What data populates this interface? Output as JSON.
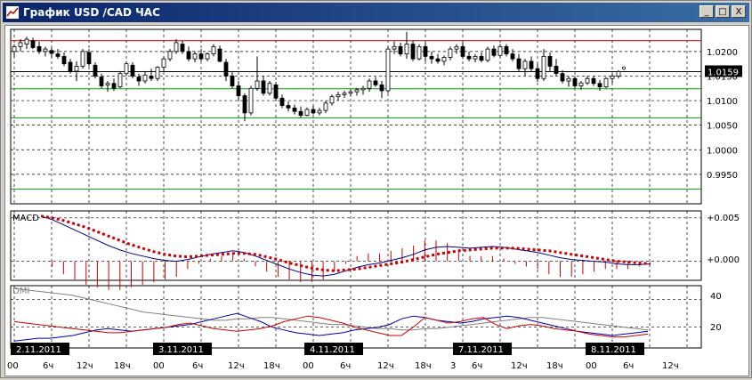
{
  "window": {
    "title": "График USD /CAD  ЧАС",
    "minimize_label": "_",
    "maximize_label": "□",
    "close_label": "X"
  },
  "price_panel": {
    "levels": [
      1.02,
      1.015,
      1.01,
      1.005,
      1.0,
      0.995
    ],
    "level_labels": [
      "1.0200",
      "1.0150",
      "1.0100",
      "1.0050",
      "1.0000",
      "0.9950"
    ],
    "current_price": 1.0159,
    "current_price_label": "1.0159",
    "red_line": 1.0222,
    "green_lines": [
      1.0124,
      1.0065,
      0.992
    ],
    "colors": {
      "red_line": "#c00000",
      "green_line": "#00a000",
      "price_line": "#000000"
    },
    "candles": [
      [
        1.02,
        1.0215,
        1.019,
        1.021
      ],
      [
        1.021,
        1.0225,
        1.02,
        1.0218
      ],
      [
        1.0215,
        1.023,
        1.0205,
        1.0225
      ],
      [
        1.0222,
        1.0228,
        1.0205,
        1.0208
      ],
      [
        1.021,
        1.022,
        1.0195,
        1.02
      ],
      [
        1.02,
        1.021,
        1.019,
        1.0205
      ],
      [
        1.0202,
        1.0208,
        1.0188,
        1.0196
      ],
      [
        1.0195,
        1.0205,
        1.0185,
        1.019
      ],
      [
        1.019,
        1.0198,
        1.017,
        1.0175
      ],
      [
        1.0178,
        1.0185,
        1.0155,
        1.016
      ],
      [
        1.016,
        1.018,
        1.014,
        1.017
      ],
      [
        1.017,
        1.0205,
        1.0165,
        1.02
      ],
      [
        1.0198,
        1.0205,
        1.017,
        1.0175
      ],
      [
        1.0172,
        1.0178,
        1.0145,
        1.015
      ],
      [
        1.0148,
        1.0155,
        1.0125,
        1.013
      ],
      [
        1.0132,
        1.014,
        1.0118,
        1.0135
      ],
      [
        1.0135,
        1.0145,
        1.012,
        1.0125
      ],
      [
        1.0128,
        1.016,
        1.0125,
        1.0155
      ],
      [
        1.0155,
        1.018,
        1.015,
        1.0175
      ],
      [
        1.0172,
        1.0178,
        1.0145,
        1.015
      ],
      [
        1.0148,
        1.0155,
        1.013,
        1.014
      ],
      [
        1.014,
        1.016,
        1.0135,
        1.0152
      ],
      [
        1.015,
        1.0165,
        1.014,
        1.0145
      ],
      [
        1.0145,
        1.017,
        1.014,
        1.0168
      ],
      [
        1.0168,
        1.019,
        1.016,
        1.0185
      ],
      [
        1.0185,
        1.0205,
        1.018,
        1.02
      ],
      [
        1.02,
        1.0225,
        1.0195,
        1.0218
      ],
      [
        1.0215,
        1.0222,
        1.0195,
        1.02
      ],
      [
        1.02,
        1.021,
        1.018,
        1.0185
      ],
      [
        1.0185,
        1.02,
        1.0178,
        1.0195
      ],
      [
        1.0195,
        1.0205,
        1.018,
        1.0185
      ],
      [
        1.0185,
        1.0198,
        1.018,
        1.0195
      ],
      [
        1.0195,
        1.0215,
        1.019,
        1.021
      ],
      [
        1.0205,
        1.0212,
        1.0178,
        1.018
      ],
      [
        1.0178,
        1.0185,
        1.014,
        1.015
      ],
      [
        1.015,
        1.016,
        1.0125,
        1.013
      ],
      [
        1.013,
        1.014,
        1.01,
        1.011
      ],
      [
        1.011,
        1.0115,
        1.0058,
        1.0075
      ],
      [
        1.0075,
        1.013,
        1.007,
        1.0125
      ],
      [
        1.0125,
        1.019,
        1.012,
        1.014
      ],
      [
        1.014,
        1.015,
        1.011,
        1.0115
      ],
      [
        1.0115,
        1.014,
        1.011,
        1.0135
      ],
      [
        1.0132,
        1.0138,
        1.01,
        1.0105
      ],
      [
        1.0105,
        1.0112,
        1.0085,
        1.009
      ],
      [
        1.009,
        1.0098,
        1.0078,
        1.0085
      ],
      [
        1.0085,
        1.0092,
        1.0072,
        1.0078
      ],
      [
        1.0078,
        1.0088,
        1.0065,
        1.007
      ],
      [
        1.007,
        1.0086,
        1.0068,
        1.0082
      ],
      [
        1.0082,
        1.009,
        1.0072,
        1.0075
      ],
      [
        1.0075,
        1.0085,
        1.007,
        1.008
      ],
      [
        1.008,
        1.01,
        1.0075,
        1.0095
      ],
      [
        1.0095,
        1.0112,
        1.009,
        1.0108
      ],
      [
        1.0108,
        1.0118,
        1.01,
        1.0112
      ],
      [
        1.0112,
        1.012,
        1.0105,
        1.0115
      ],
      [
        1.0115,
        1.0122,
        1.0108,
        1.0118
      ],
      [
        1.0118,
        1.0126,
        1.011,
        1.0122
      ],
      [
        1.0122,
        1.013,
        1.0112,
        1.0125
      ],
      [
        1.0125,
        1.0145,
        1.0118,
        1.014
      ],
      [
        1.014,
        1.0148,
        1.0128,
        1.0132
      ],
      [
        1.0132,
        1.014,
        1.0105,
        1.012
      ],
      [
        1.012,
        1.021,
        1.0115,
        1.0205
      ],
      [
        1.0205,
        1.022,
        1.0195,
        1.021
      ],
      [
        1.021,
        1.0218,
        1.019,
        1.0195
      ],
      [
        1.0195,
        1.024,
        1.0185,
        1.0215
      ],
      [
        1.0215,
        1.0222,
        1.018,
        1.0185
      ],
      [
        1.0185,
        1.0215,
        1.0182,
        1.021
      ],
      [
        1.021,
        1.0218,
        1.018,
        1.019
      ],
      [
        1.019,
        1.02,
        1.0175,
        1.0185
      ],
      [
        1.0185,
        1.0195,
        1.0175,
        1.018
      ],
      [
        1.018,
        1.0192,
        1.0172,
        1.0188
      ],
      [
        1.0188,
        1.021,
        1.0182,
        1.0205
      ],
      [
        1.0205,
        1.0215,
        1.0195,
        1.021
      ],
      [
        1.021,
        1.0218,
        1.0185,
        1.019
      ],
      [
        1.019,
        1.02,
        1.018,
        1.0185
      ],
      [
        1.0185,
        1.0195,
        1.0178,
        1.019
      ],
      [
        1.019,
        1.0198,
        1.0178,
        1.0182
      ],
      [
        1.0182,
        1.021,
        1.0178,
        1.0205
      ],
      [
        1.0205,
        1.0212,
        1.0188,
        1.0192
      ],
      [
        1.0192,
        1.0215,
        1.0188,
        1.021
      ],
      [
        1.021,
        1.0215,
        1.019,
        1.0195
      ],
      [
        1.0195,
        1.0205,
        1.018,
        1.0185
      ],
      [
        1.0185,
        1.0195,
        1.016,
        1.0165
      ],
      [
        1.0165,
        1.0185,
        1.015,
        1.018
      ],
      [
        1.018,
        1.019,
        1.016,
        1.0165
      ],
      [
        1.0165,
        1.0175,
        1.0138,
        1.0145
      ],
      [
        1.0145,
        1.0205,
        1.014,
        1.019
      ],
      [
        1.019,
        1.0198,
        1.016,
        1.017
      ],
      [
        1.017,
        1.0185,
        1.015,
        1.0155
      ],
      [
        1.0155,
        1.0162,
        1.0135,
        1.014
      ],
      [
        1.014,
        1.015,
        1.0128,
        1.0145
      ],
      [
        1.0145,
        1.015,
        1.0125,
        1.013
      ],
      [
        1.013,
        1.014,
        1.0122,
        1.0136
      ],
      [
        1.0136,
        1.015,
        1.0132,
        1.0145
      ],
      [
        1.0145,
        1.015,
        1.013,
        1.0135
      ],
      [
        1.0135,
        1.0142,
        1.012,
        1.0128
      ],
      [
        1.0128,
        1.0148,
        1.0125,
        1.0145
      ],
      [
        1.0145,
        1.0155,
        1.0135,
        1.015
      ],
      [
        1.015,
        1.0162,
        1.0145,
        1.0159
      ]
    ]
  },
  "macd_panel": {
    "label": "MACD",
    "axis_labels": [
      "+0.005",
      "+0.000"
    ],
    "macd_line": [
      0.0052,
      0.0048,
      0.0042,
      0.0036,
      0.003,
      0.0024,
      0.0018,
      0.0013,
      0.0009,
      0.0006,
      0.0003,
      0.0001,
      0.0,
      0.0002,
      0.0005,
      0.0008,
      0.001,
      0.0012,
      0.001,
      0.0006,
      0.0001,
      -0.0004,
      -0.0009,
      -0.0013,
      -0.0016,
      -0.0017,
      -0.0015,
      -0.0011,
      -0.0007,
      -0.0004,
      -0.0002,
      0.0001,
      0.0004,
      0.0008,
      0.0013,
      0.0016,
      0.0017,
      0.0016,
      0.0015,
      0.0016,
      0.0017,
      0.0016,
      0.0014,
      0.0012,
      0.001,
      0.0007,
      0.0004,
      0.0002,
      0.0001,
      0.0,
      -0.0001,
      -0.0003,
      -0.0004,
      -0.0004,
      -0.0003
    ],
    "signal_line": [
      0.0052,
      0.005,
      0.0047,
      0.0043,
      0.0039,
      0.0034,
      0.0029,
      0.0024,
      0.0019,
      0.0015,
      0.0011,
      0.0008,
      0.0006,
      0.0005,
      0.0006,
      0.0007,
      0.0008,
      0.0009,
      0.0009,
      0.0008,
      0.0005,
      0.0002,
      -0.0002,
      -0.0005,
      -0.0008,
      -0.001,
      -0.0011,
      -0.001,
      -0.0009,
      -0.0007,
      -0.0005,
      -0.0003,
      -0.0001,
      0.0002,
      0.0005,
      0.0008,
      0.001,
      0.0012,
      0.0013,
      0.0014,
      0.0015,
      0.0015,
      0.0015,
      0.0014,
      0.0013,
      0.0012,
      0.001,
      0.0008,
      0.0006,
      0.0004,
      0.0002,
      0.0,
      -0.0001,
      -0.0002,
      -0.0003
    ],
    "colors": {
      "macd": "#000080",
      "signal": "#cc0000"
    }
  },
  "dmi_panel": {
    "label": "DMI",
    "axis_labels": [
      "40",
      "20"
    ],
    "adx": [
      48,
      47,
      46,
      45,
      44,
      43,
      41,
      39,
      37,
      35,
      33,
      31,
      30,
      29,
      28,
      27,
      26,
      25,
      25,
      26,
      26,
      27,
      27,
      26,
      25,
      24,
      23,
      22,
      22,
      21,
      20,
      19,
      19,
      18,
      18,
      19,
      19,
      20,
      21,
      22,
      23,
      24,
      25,
      26,
      27,
      27,
      26,
      25,
      24,
      23,
      22,
      21,
      20,
      19,
      18
    ],
    "plus_di": [
      10,
      11,
      12,
      12,
      13,
      14,
      16,
      18,
      19,
      18,
      17,
      18,
      19,
      20,
      21,
      22,
      24,
      26,
      28,
      30,
      27,
      24,
      20,
      18,
      16,
      15,
      14,
      15,
      16,
      18,
      19,
      20,
      22,
      26,
      28,
      27,
      25,
      24,
      23,
      24,
      26,
      27,
      28,
      27,
      25,
      23,
      21,
      19,
      17,
      16,
      15,
      14,
      15,
      16,
      17
    ],
    "minus_di": [
      24,
      23,
      22,
      21,
      20,
      19,
      18,
      17,
      16,
      16,
      17,
      18,
      19,
      20,
      22,
      23,
      21,
      19,
      18,
      17,
      18,
      19,
      21,
      24,
      26,
      28,
      27,
      25,
      23,
      20,
      18,
      16,
      14,
      14,
      20,
      27,
      25,
      23,
      24,
      26,
      27,
      22,
      19,
      21,
      22,
      21,
      19,
      18,
      17,
      15,
      14,
      13,
      13,
      14,
      15
    ],
    "colors": {
      "adx": "#808080",
      "plus_di": "#0000aa",
      "minus_di": "#cc0000"
    }
  },
  "time_axis": {
    "date_labels": [
      "2.11.2011",
      "3.11.2011",
      "4.11.2011",
      "7.11.2011",
      "8.11.2011"
    ],
    "tick_labels": [
      "00",
      "6ч",
      "12ч",
      "18ч",
      "00",
      "6ч",
      "12ч",
      "18ч",
      "00",
      "6ч",
      "12ч",
      "18ч",
      "3",
      "6ч",
      "12ч",
      "18ч",
      "00",
      "6ч",
      "12ч"
    ]
  }
}
